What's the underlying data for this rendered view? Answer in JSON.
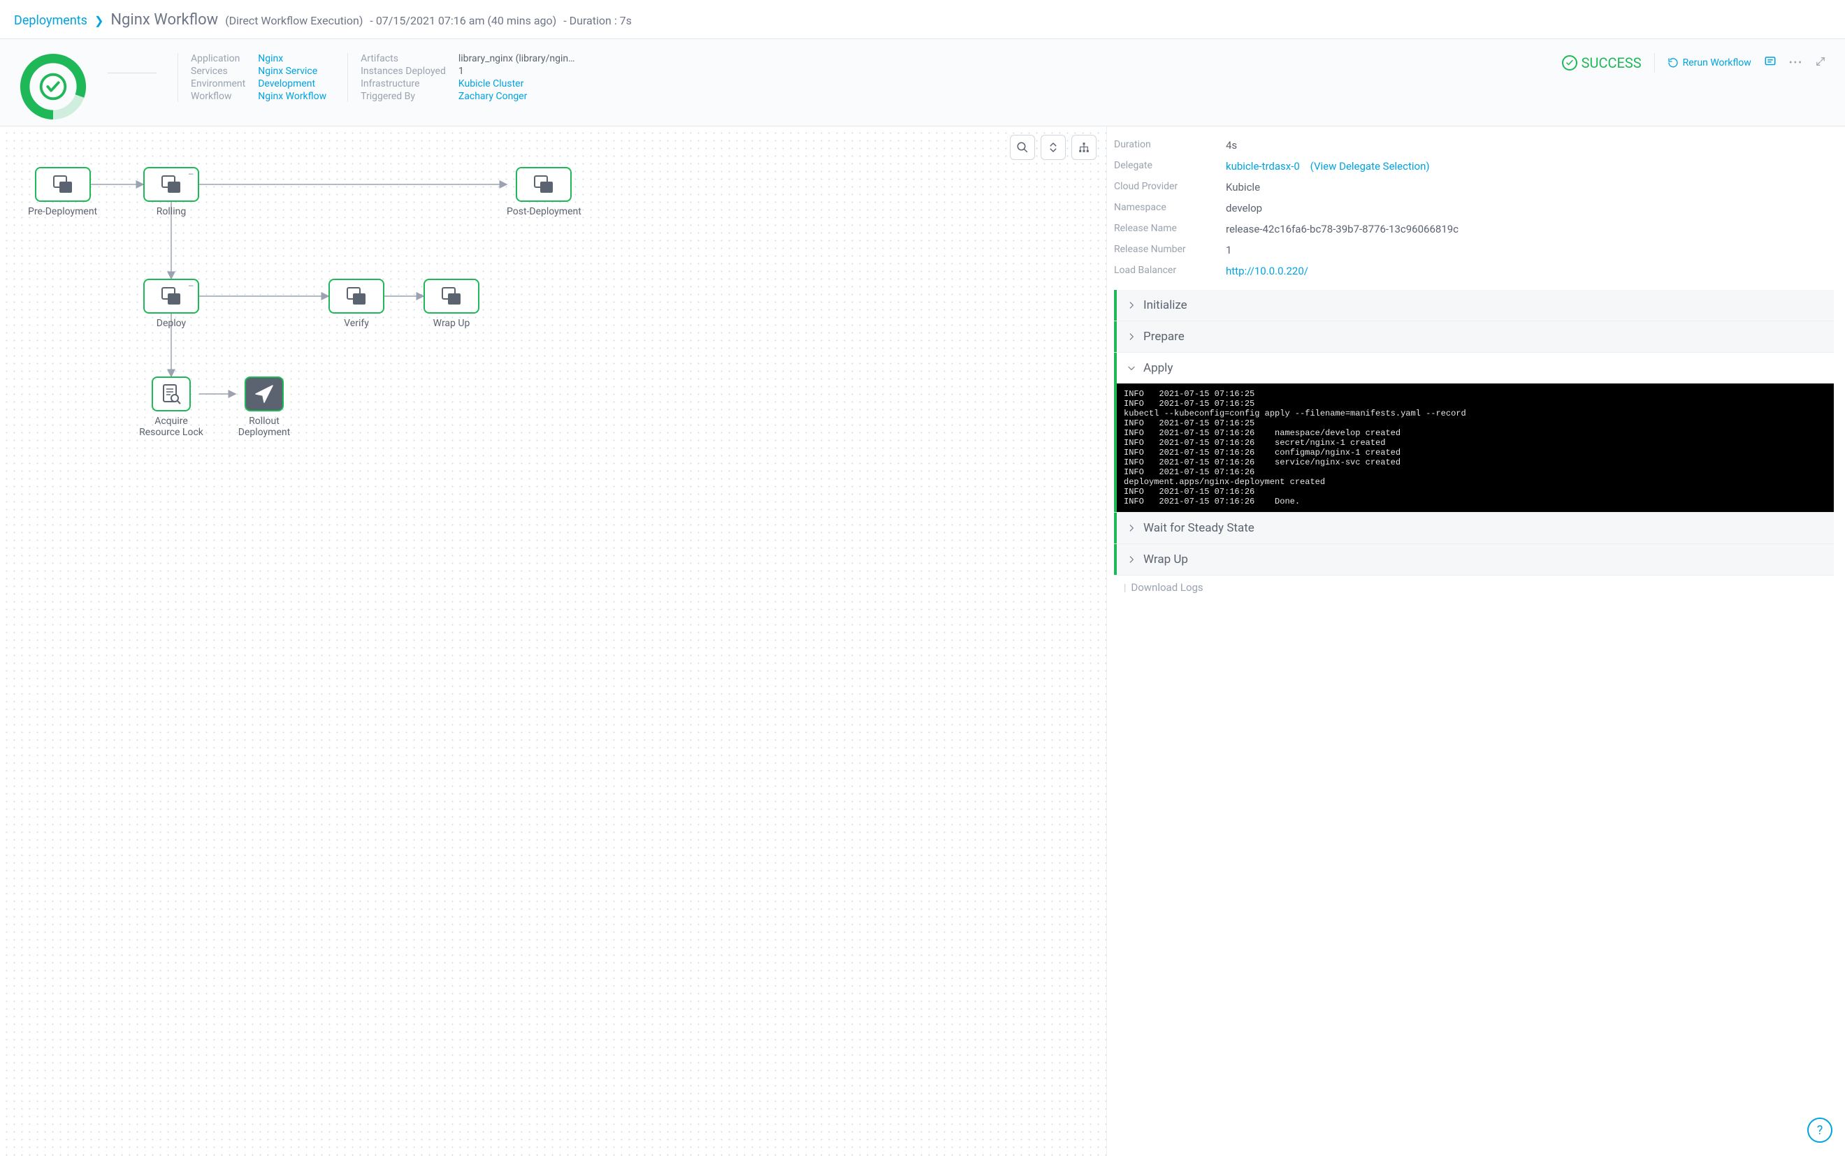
{
  "breadcrumb": {
    "root": "Deployments",
    "title": "Nginx Workflow",
    "exec_type": "(Direct Workflow Execution)",
    "timestamp": "- 07/15/2021 07:16 am (40 mins ago)",
    "duration": "- Duration : 7s"
  },
  "summary": {
    "left_labels": {
      "application": "Application",
      "services": "Services",
      "environment": "Environment",
      "workflow": "Workflow"
    },
    "left_values": {
      "application": "Nginx",
      "services": "Nginx Service",
      "environment": "Development",
      "workflow": "Nginx Workflow"
    },
    "right_labels": {
      "artifacts": "Artifacts",
      "instances": "Instances Deployed",
      "infrastructure": "Infrastructure",
      "triggered": "Triggered By"
    },
    "right_values": {
      "artifacts": "library_nginx (library/ngin…",
      "instances": "1",
      "infrastructure": "Kubicle Cluster",
      "triggered": "Zachary Conger"
    },
    "status": "SUCCESS",
    "rerun": "Rerun Workflow"
  },
  "graph": {
    "pre": "Pre-Deployment",
    "rolling": "Rolling",
    "post": "Post-Deployment",
    "deploy": "Deploy",
    "verify": "Verify",
    "wrapup": "Wrap Up",
    "acquire": "Acquire\nResource Lock",
    "rollout": "Rollout\nDeployment"
  },
  "details": {
    "rows": {
      "duration_l": "Duration",
      "duration_v": "4s",
      "delegate_l": "Delegate",
      "delegate_v": "kubicle-trdasx-0",
      "delegate_extra": "(View Delegate Selection)",
      "cloud_l": "Cloud Provider",
      "cloud_v": "Kubicle",
      "namespace_l": "Namespace",
      "namespace_v": "develop",
      "release_name_l": "Release Name",
      "release_name_v": "release-42c16fa6-bc78-39b7-8776-13c96066819c",
      "release_num_l": "Release Number",
      "release_num_v": "1",
      "lb_l": "Load Balancer",
      "lb_v": "http://10.0.0.220/"
    },
    "phases": {
      "initialize": "Initialize",
      "prepare": "Prepare",
      "apply": "Apply",
      "wait": "Wait for Steady State",
      "wrap": "Wrap Up"
    },
    "apply_log": "INFO   2021-07-15 07:16:25\nINFO   2021-07-15 07:16:25\nkubectl --kubeconfig=config apply --filename=manifests.yaml --record\nINFO   2021-07-15 07:16:25\nINFO   2021-07-15 07:16:26    namespace/develop created\nINFO   2021-07-15 07:16:26    secret/nginx-1 created\nINFO   2021-07-15 07:16:26    configmap/nginx-1 created\nINFO   2021-07-15 07:16:26    service/nginx-svc created\nINFO   2021-07-15 07:16:26\ndeployment.apps/nginx-deployment created\nINFO   2021-07-15 07:16:26\nINFO   2021-07-15 07:16:26    Done.",
    "download": "Download Logs"
  }
}
